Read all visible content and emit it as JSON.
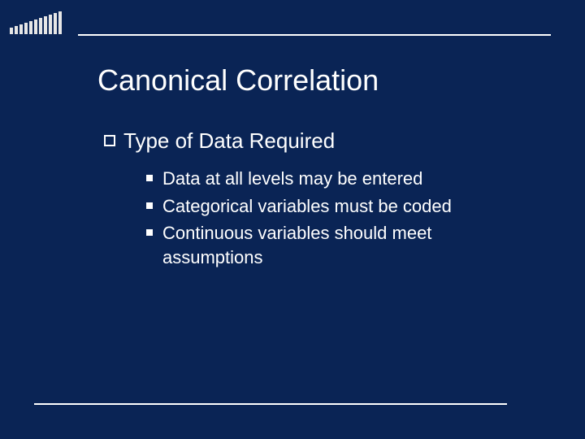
{
  "title": "Canonical Correlation",
  "level1": {
    "label": "Type of Data Required"
  },
  "level2": [
    {
      "text": "Data at all levels may be entered"
    },
    {
      "text": "Categorical variables must be coded"
    },
    {
      "text": "Continuous variables should meet assumptions"
    }
  ],
  "colors": {
    "background": "#0a2455",
    "text": "#ffffff",
    "rule": "#ffffff"
  }
}
